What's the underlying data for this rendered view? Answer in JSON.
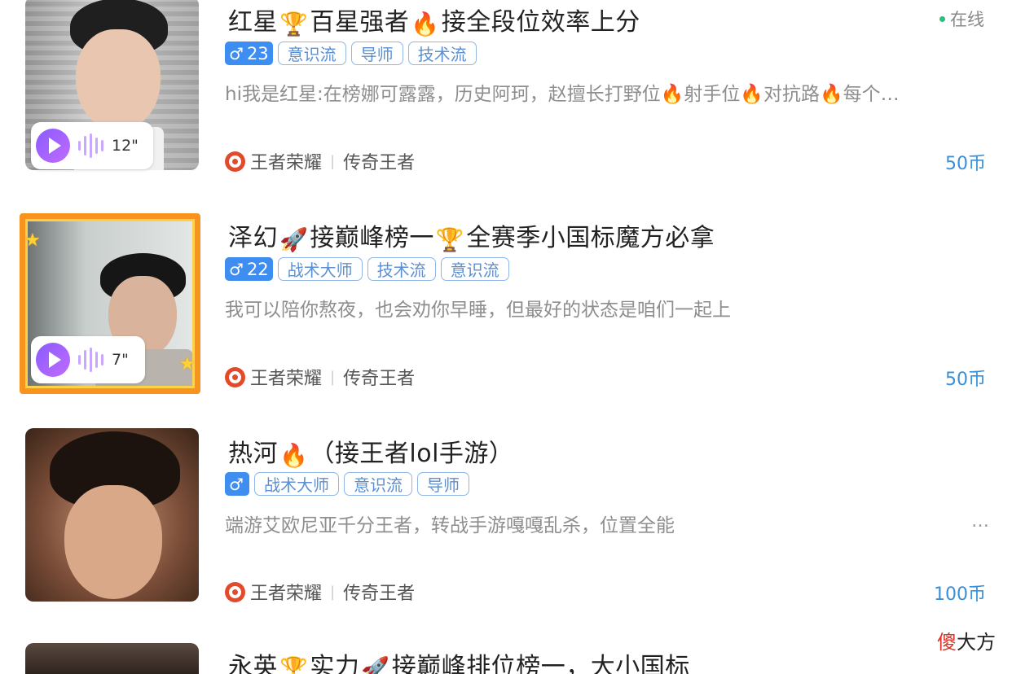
{
  "status_text": "在线",
  "colors": {
    "tag_border": "#8fb6e6",
    "tag_text": "#5b8fd2",
    "gender_badge": "#3d8ef0",
    "price": "#3a8fd6",
    "online_dot": "#2bc07a",
    "frame": "#f7931e"
  },
  "cards": [
    {
      "title_parts": [
        "红星",
        "百星强者",
        "接全段位效率上分"
      ],
      "title_icons": [
        "trophy-icon",
        "fire-icon"
      ],
      "gender_symbol": "♂",
      "age": "23",
      "tags": [
        "意识流",
        "导师",
        "技术流"
      ],
      "bio": "hi我是红星:在榜娜可露露，历史阿珂，赵擅长打野位🔥射手位🔥对抗路🔥每个…",
      "voice_duration": "12\"",
      "game": "王者荣耀",
      "rank": "传奇王者",
      "price": "50币"
    },
    {
      "title_parts": [
        "泽幻",
        "接巅峰榜一",
        "全赛季小国标魔方必拿"
      ],
      "title_icons": [
        "rocket-icon",
        "trophy-icon"
      ],
      "gender_symbol": "♂",
      "age": "22",
      "tags": [
        "战术大师",
        "技术流",
        "意识流"
      ],
      "bio": "我可以陪你熬夜，也会劝你早睡，但最好的状态是咱们一起上",
      "voice_duration": "7\"",
      "game": "王者荣耀",
      "rank": "传奇王者",
      "price": "50币"
    },
    {
      "title_parts": [
        "热河",
        "（接王者lol手游）"
      ],
      "title_icons": [
        "fire-icon"
      ],
      "gender_symbol": "♂",
      "age": "",
      "tags": [
        "战术大师",
        "意识流",
        "导师"
      ],
      "bio": "端游艾欧尼亚千分王者，转战手游嘎嘎乱杀，位置全能",
      "more": "…",
      "game": "王者荣耀",
      "rank": "传奇王者",
      "price": "100币"
    },
    {
      "title_parts": [
        "永英",
        "实力",
        "接巅峰排位榜一，大小国标"
      ],
      "title_icons": [
        "trophy-icon",
        "rocket-icon"
      ]
    }
  ],
  "watermark": {
    "accent": "傻",
    "rest": "大方"
  }
}
